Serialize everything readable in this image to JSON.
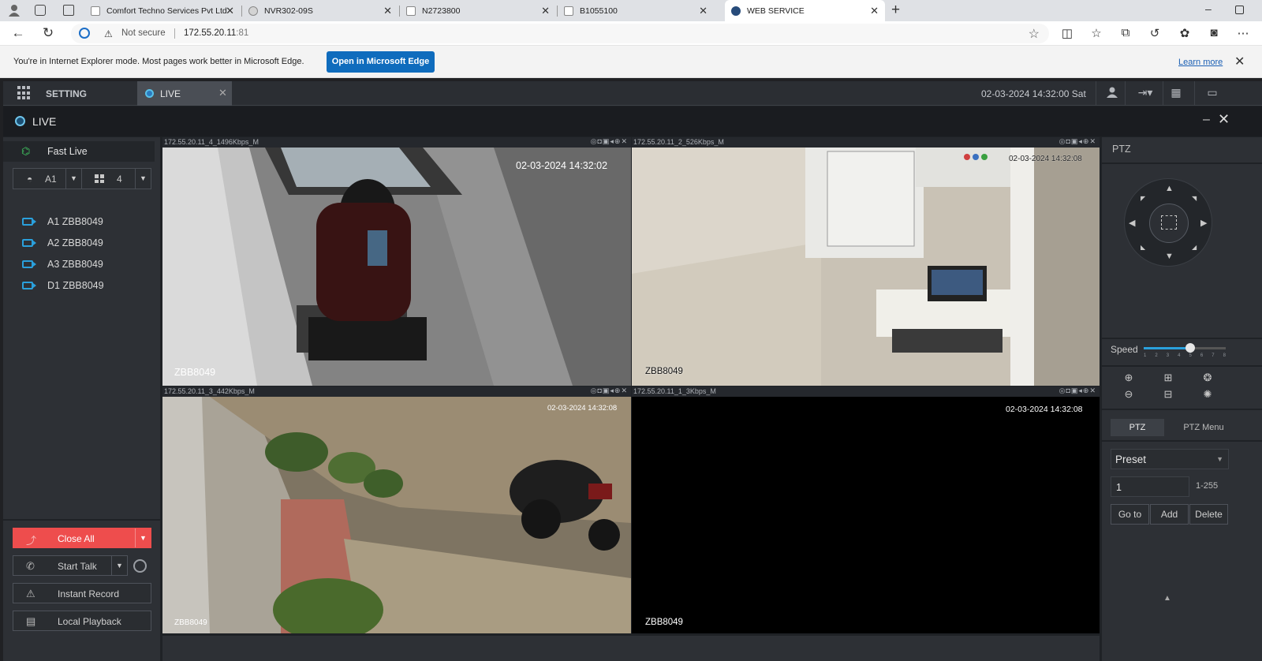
{
  "browser": {
    "tabs": [
      {
        "title": "Comfort Techno Services Pvt Ltd",
        "icon": "site-favicon"
      },
      {
        "title": "NVR302-09S",
        "icon": "edge-favicon"
      },
      {
        "title": "N2723800",
        "icon": "page-icon"
      },
      {
        "title": "B1055100",
        "icon": "page-icon"
      },
      {
        "title": "WEB SERVICE",
        "icon": "globe-icon",
        "active": true
      }
    ],
    "address": {
      "security": "Not secure",
      "host": "172.55.20.11",
      "port": ":81"
    },
    "ie_mode": {
      "message": "You're in Internet Explorer mode. Most pages work better in Microsoft Edge.",
      "button": "Open in Microsoft Edge",
      "learn_more": "Learn more"
    }
  },
  "app": {
    "top": {
      "setting": "SETTING",
      "live_tab": "LIVE",
      "datetime": "02-03-2024 14:32:00 Sat"
    },
    "live_header": "LIVE",
    "left": {
      "fast_live": "Fast Live",
      "stream_select": "A1",
      "layout_select": "4",
      "channels": [
        "A1 ZBB8049",
        "A2 ZBB8049",
        "A3 ZBB8049",
        "D1 ZBB8049"
      ],
      "close_all": "Close All",
      "start_talk": "Start Talk",
      "instant_record": "Instant Record",
      "local_playback": "Local Playback"
    },
    "cells": [
      {
        "header": "172.55.20.11_4_1496Kbps_M",
        "timestamp": "02-03-2024 14:32:02",
        "name": "ZBB8049",
        "selected": true
      },
      {
        "header": "172.55.20.11_2_526Kbps_M",
        "timestamp": "02-03-2024 14:32:08",
        "name": "ZBB8049"
      },
      {
        "header": "172.55.20.11_3_442Kbps_M",
        "timestamp": "02-03-2024 14:32:08",
        "name": "ZBB8049"
      },
      {
        "header": "172.55.20.11_1_3Kbps_M",
        "timestamp": "02-03-2024 14:32:08",
        "name": "ZBB8049"
      }
    ],
    "ptz": {
      "title": "PTZ",
      "speed_label": "Speed",
      "speed_value": 5,
      "speed_max": 8,
      "speed_ticks": [
        "1",
        "2",
        "3",
        "4",
        "5",
        "6",
        "7",
        "8"
      ],
      "tab_ptz": "PTZ",
      "tab_menu": "PTZ Menu",
      "preset_label": "Preset",
      "preset_number": "1",
      "preset_range": "1-255",
      "go_to": "Go to",
      "add": "Add",
      "delete": "Delete"
    }
  },
  "colors": {
    "accent_blue": "#2aa0dc",
    "close_all_red": "#ee4d4d",
    "edge_button": "#0f6cbd",
    "selected_cell_border": "#3fbf3f"
  }
}
